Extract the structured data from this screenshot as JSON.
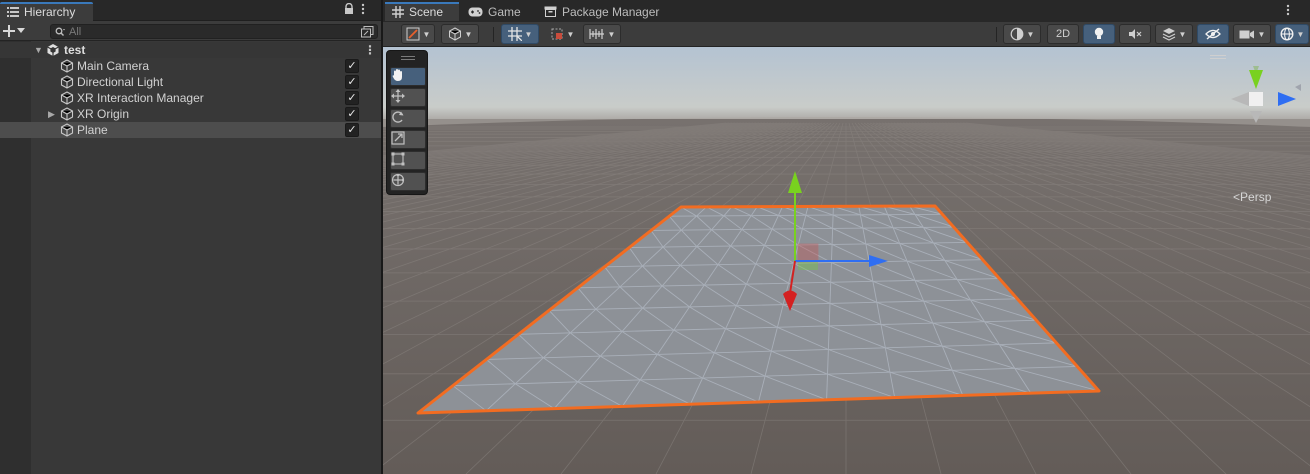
{
  "hierarchy": {
    "tab_label": "Hierarchy",
    "search_placeholder": "All",
    "scene_name": "test",
    "items": [
      {
        "label": "Main Camera",
        "expandable": false,
        "selected": false,
        "active": true
      },
      {
        "label": "Directional Light",
        "expandable": false,
        "selected": false,
        "active": true
      },
      {
        "label": "XR Interaction Manager",
        "expandable": false,
        "selected": false,
        "active": true
      },
      {
        "label": "XR Origin",
        "expandable": true,
        "selected": false,
        "active": true
      },
      {
        "label": "Plane",
        "expandable": false,
        "selected": true,
        "active": true
      }
    ]
  },
  "scene_view": {
    "tabs": [
      {
        "label": "Scene",
        "icon": "grid-icon",
        "active": true
      },
      {
        "label": "Game",
        "icon": "gamepad-icon",
        "active": false
      },
      {
        "label": "Package Manager",
        "icon": "package-icon",
        "active": false
      }
    ],
    "toolbar": {
      "toggle_2d_label": "2D"
    },
    "camera_mode_label": "Persp",
    "tools": [
      "hand-tool",
      "move-tool",
      "rotate-tool",
      "scale-tool",
      "rect-tool",
      "transform-tool"
    ],
    "active_tool": "hand-tool"
  },
  "colors": {
    "accent": "#3a79bb",
    "selection_outline": "#f26c21",
    "axis_x": "#d42121",
    "axis_y": "#79d11f",
    "axis_z": "#2f6ef2"
  }
}
